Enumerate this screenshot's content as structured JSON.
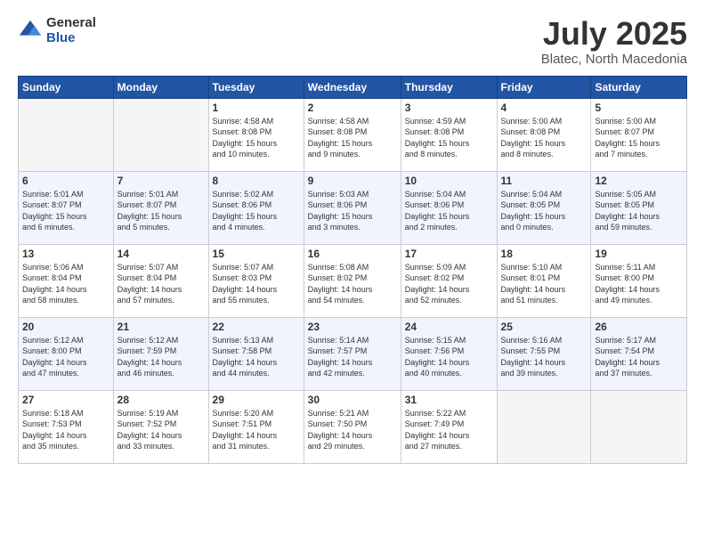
{
  "logo": {
    "general": "General",
    "blue": "Blue"
  },
  "header": {
    "month": "July 2025",
    "location": "Blatec, North Macedonia"
  },
  "weekdays": [
    "Sunday",
    "Monday",
    "Tuesday",
    "Wednesday",
    "Thursday",
    "Friday",
    "Saturday"
  ],
  "weeks": [
    [
      {
        "day": "",
        "info": ""
      },
      {
        "day": "",
        "info": ""
      },
      {
        "day": "1",
        "info": "Sunrise: 4:58 AM\nSunset: 8:08 PM\nDaylight: 15 hours\nand 10 minutes."
      },
      {
        "day": "2",
        "info": "Sunrise: 4:58 AM\nSunset: 8:08 PM\nDaylight: 15 hours\nand 9 minutes."
      },
      {
        "day": "3",
        "info": "Sunrise: 4:59 AM\nSunset: 8:08 PM\nDaylight: 15 hours\nand 8 minutes."
      },
      {
        "day": "4",
        "info": "Sunrise: 5:00 AM\nSunset: 8:08 PM\nDaylight: 15 hours\nand 8 minutes."
      },
      {
        "day": "5",
        "info": "Sunrise: 5:00 AM\nSunset: 8:07 PM\nDaylight: 15 hours\nand 7 minutes."
      }
    ],
    [
      {
        "day": "6",
        "info": "Sunrise: 5:01 AM\nSunset: 8:07 PM\nDaylight: 15 hours\nand 6 minutes."
      },
      {
        "day": "7",
        "info": "Sunrise: 5:01 AM\nSunset: 8:07 PM\nDaylight: 15 hours\nand 5 minutes."
      },
      {
        "day": "8",
        "info": "Sunrise: 5:02 AM\nSunset: 8:06 PM\nDaylight: 15 hours\nand 4 minutes."
      },
      {
        "day": "9",
        "info": "Sunrise: 5:03 AM\nSunset: 8:06 PM\nDaylight: 15 hours\nand 3 minutes."
      },
      {
        "day": "10",
        "info": "Sunrise: 5:04 AM\nSunset: 8:06 PM\nDaylight: 15 hours\nand 2 minutes."
      },
      {
        "day": "11",
        "info": "Sunrise: 5:04 AM\nSunset: 8:05 PM\nDaylight: 15 hours\nand 0 minutes."
      },
      {
        "day": "12",
        "info": "Sunrise: 5:05 AM\nSunset: 8:05 PM\nDaylight: 14 hours\nand 59 minutes."
      }
    ],
    [
      {
        "day": "13",
        "info": "Sunrise: 5:06 AM\nSunset: 8:04 PM\nDaylight: 14 hours\nand 58 minutes."
      },
      {
        "day": "14",
        "info": "Sunrise: 5:07 AM\nSunset: 8:04 PM\nDaylight: 14 hours\nand 57 minutes."
      },
      {
        "day": "15",
        "info": "Sunrise: 5:07 AM\nSunset: 8:03 PM\nDaylight: 14 hours\nand 55 minutes."
      },
      {
        "day": "16",
        "info": "Sunrise: 5:08 AM\nSunset: 8:02 PM\nDaylight: 14 hours\nand 54 minutes."
      },
      {
        "day": "17",
        "info": "Sunrise: 5:09 AM\nSunset: 8:02 PM\nDaylight: 14 hours\nand 52 minutes."
      },
      {
        "day": "18",
        "info": "Sunrise: 5:10 AM\nSunset: 8:01 PM\nDaylight: 14 hours\nand 51 minutes."
      },
      {
        "day": "19",
        "info": "Sunrise: 5:11 AM\nSunset: 8:00 PM\nDaylight: 14 hours\nand 49 minutes."
      }
    ],
    [
      {
        "day": "20",
        "info": "Sunrise: 5:12 AM\nSunset: 8:00 PM\nDaylight: 14 hours\nand 47 minutes."
      },
      {
        "day": "21",
        "info": "Sunrise: 5:12 AM\nSunset: 7:59 PM\nDaylight: 14 hours\nand 46 minutes."
      },
      {
        "day": "22",
        "info": "Sunrise: 5:13 AM\nSunset: 7:58 PM\nDaylight: 14 hours\nand 44 minutes."
      },
      {
        "day": "23",
        "info": "Sunrise: 5:14 AM\nSunset: 7:57 PM\nDaylight: 14 hours\nand 42 minutes."
      },
      {
        "day": "24",
        "info": "Sunrise: 5:15 AM\nSunset: 7:56 PM\nDaylight: 14 hours\nand 40 minutes."
      },
      {
        "day": "25",
        "info": "Sunrise: 5:16 AM\nSunset: 7:55 PM\nDaylight: 14 hours\nand 39 minutes."
      },
      {
        "day": "26",
        "info": "Sunrise: 5:17 AM\nSunset: 7:54 PM\nDaylight: 14 hours\nand 37 minutes."
      }
    ],
    [
      {
        "day": "27",
        "info": "Sunrise: 5:18 AM\nSunset: 7:53 PM\nDaylight: 14 hours\nand 35 minutes."
      },
      {
        "day": "28",
        "info": "Sunrise: 5:19 AM\nSunset: 7:52 PM\nDaylight: 14 hours\nand 33 minutes."
      },
      {
        "day": "29",
        "info": "Sunrise: 5:20 AM\nSunset: 7:51 PM\nDaylight: 14 hours\nand 31 minutes."
      },
      {
        "day": "30",
        "info": "Sunrise: 5:21 AM\nSunset: 7:50 PM\nDaylight: 14 hours\nand 29 minutes."
      },
      {
        "day": "31",
        "info": "Sunrise: 5:22 AM\nSunset: 7:49 PM\nDaylight: 14 hours\nand 27 minutes."
      },
      {
        "day": "",
        "info": ""
      },
      {
        "day": "",
        "info": ""
      }
    ]
  ]
}
